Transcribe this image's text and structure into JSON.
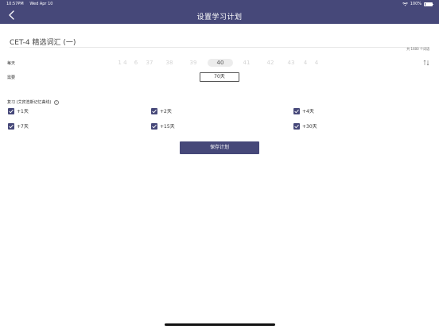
{
  "status_bar": {
    "time": "10:57PM",
    "date": "Wed Apr 10",
    "battery": "100%"
  },
  "header": {
    "title": "设置学习计划"
  },
  "book": {
    "title": "CET-4 精选词汇 (一)",
    "total_words": "共 1600 个词语"
  },
  "daily": {
    "label": "每天",
    "picker_values": [
      "1 4",
      "6",
      "37",
      "38",
      "39",
      "40",
      "41",
      "42",
      "43",
      "4",
      "4"
    ],
    "selected_value": "40"
  },
  "duration": {
    "label": "需要",
    "value": "70天"
  },
  "review": {
    "title": "复习 (艾宾浩斯记忆曲线)",
    "info_icon": "?",
    "items": [
      {
        "label": "+1天",
        "checked": true
      },
      {
        "label": "+2天",
        "checked": true
      },
      {
        "label": "+4天",
        "checked": true
      },
      {
        "label": "+7天",
        "checked": true
      },
      {
        "label": "+15天",
        "checked": true
      },
      {
        "label": "+30天",
        "checked": true
      }
    ]
  },
  "actions": {
    "save_label": "保存计划"
  },
  "colors": {
    "accent": "#464879"
  }
}
